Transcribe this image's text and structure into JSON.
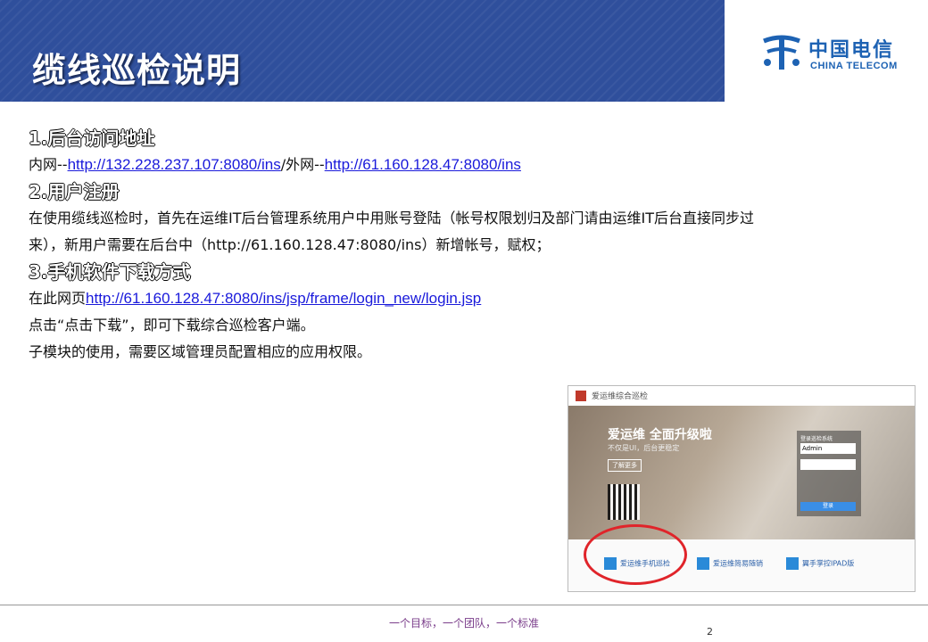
{
  "header": {
    "title": "缆线巡检说明"
  },
  "logo": {
    "cn": "中国电信",
    "en": "CHINA TELECOM"
  },
  "sections": {
    "s1_heading": "1.后台访问地址",
    "s1_inner_prefix": "内网--",
    "s1_inner_url": "http://132.228.237.107:8080/ins",
    "s1_sep": "/外网--",
    "s1_outer_url": "http://61.160.128.47:8080/ins",
    "s2_heading": "2.用户注册",
    "s2_line1": "在使用缆线巡检时，首先在运维IT后台管理系统用户中用账号登陆（帐号权限划归及部门请由运维IT后台直接同步过",
    "s2_line2": "来），新用户需要在后台中（http://61.160.128.47:8080/ins）新增帐号，赋权；",
    "s3_heading": "3.手机软件下载方式",
    "s3_prefix": "在此网页",
    "s3_url": "http://61.160.128.47:8080/ins/jsp/frame/login_new/login.jsp",
    "s3_line2": "点击“点击下载”，即可下载综合巡检客户端。",
    "s3_line3": "子模块的使用，需要区域管理员配置相应的应用权限。"
  },
  "screenshot": {
    "app_title": "爱运维综合巡检",
    "banner_big": "爱运维  全面升级啦",
    "banner_sub": "不仅是UI，后台更稳定",
    "banner_btn": "了解更多",
    "login_label": "登录巡检系统",
    "login_user": "Admin",
    "login_btn": "登录",
    "app1": "爱运维手机巡检",
    "app2": "爱运维简易随销",
    "app3": "翼手掌控IPAD版"
  },
  "footer": {
    "slogan": "一个目标，一个团队，一个标准",
    "page": "2"
  },
  "colors": {
    "header": "#2f4f9c",
    "link": "#1a1adb",
    "circle": "#e0242a",
    "logo": "#1d62b3"
  }
}
